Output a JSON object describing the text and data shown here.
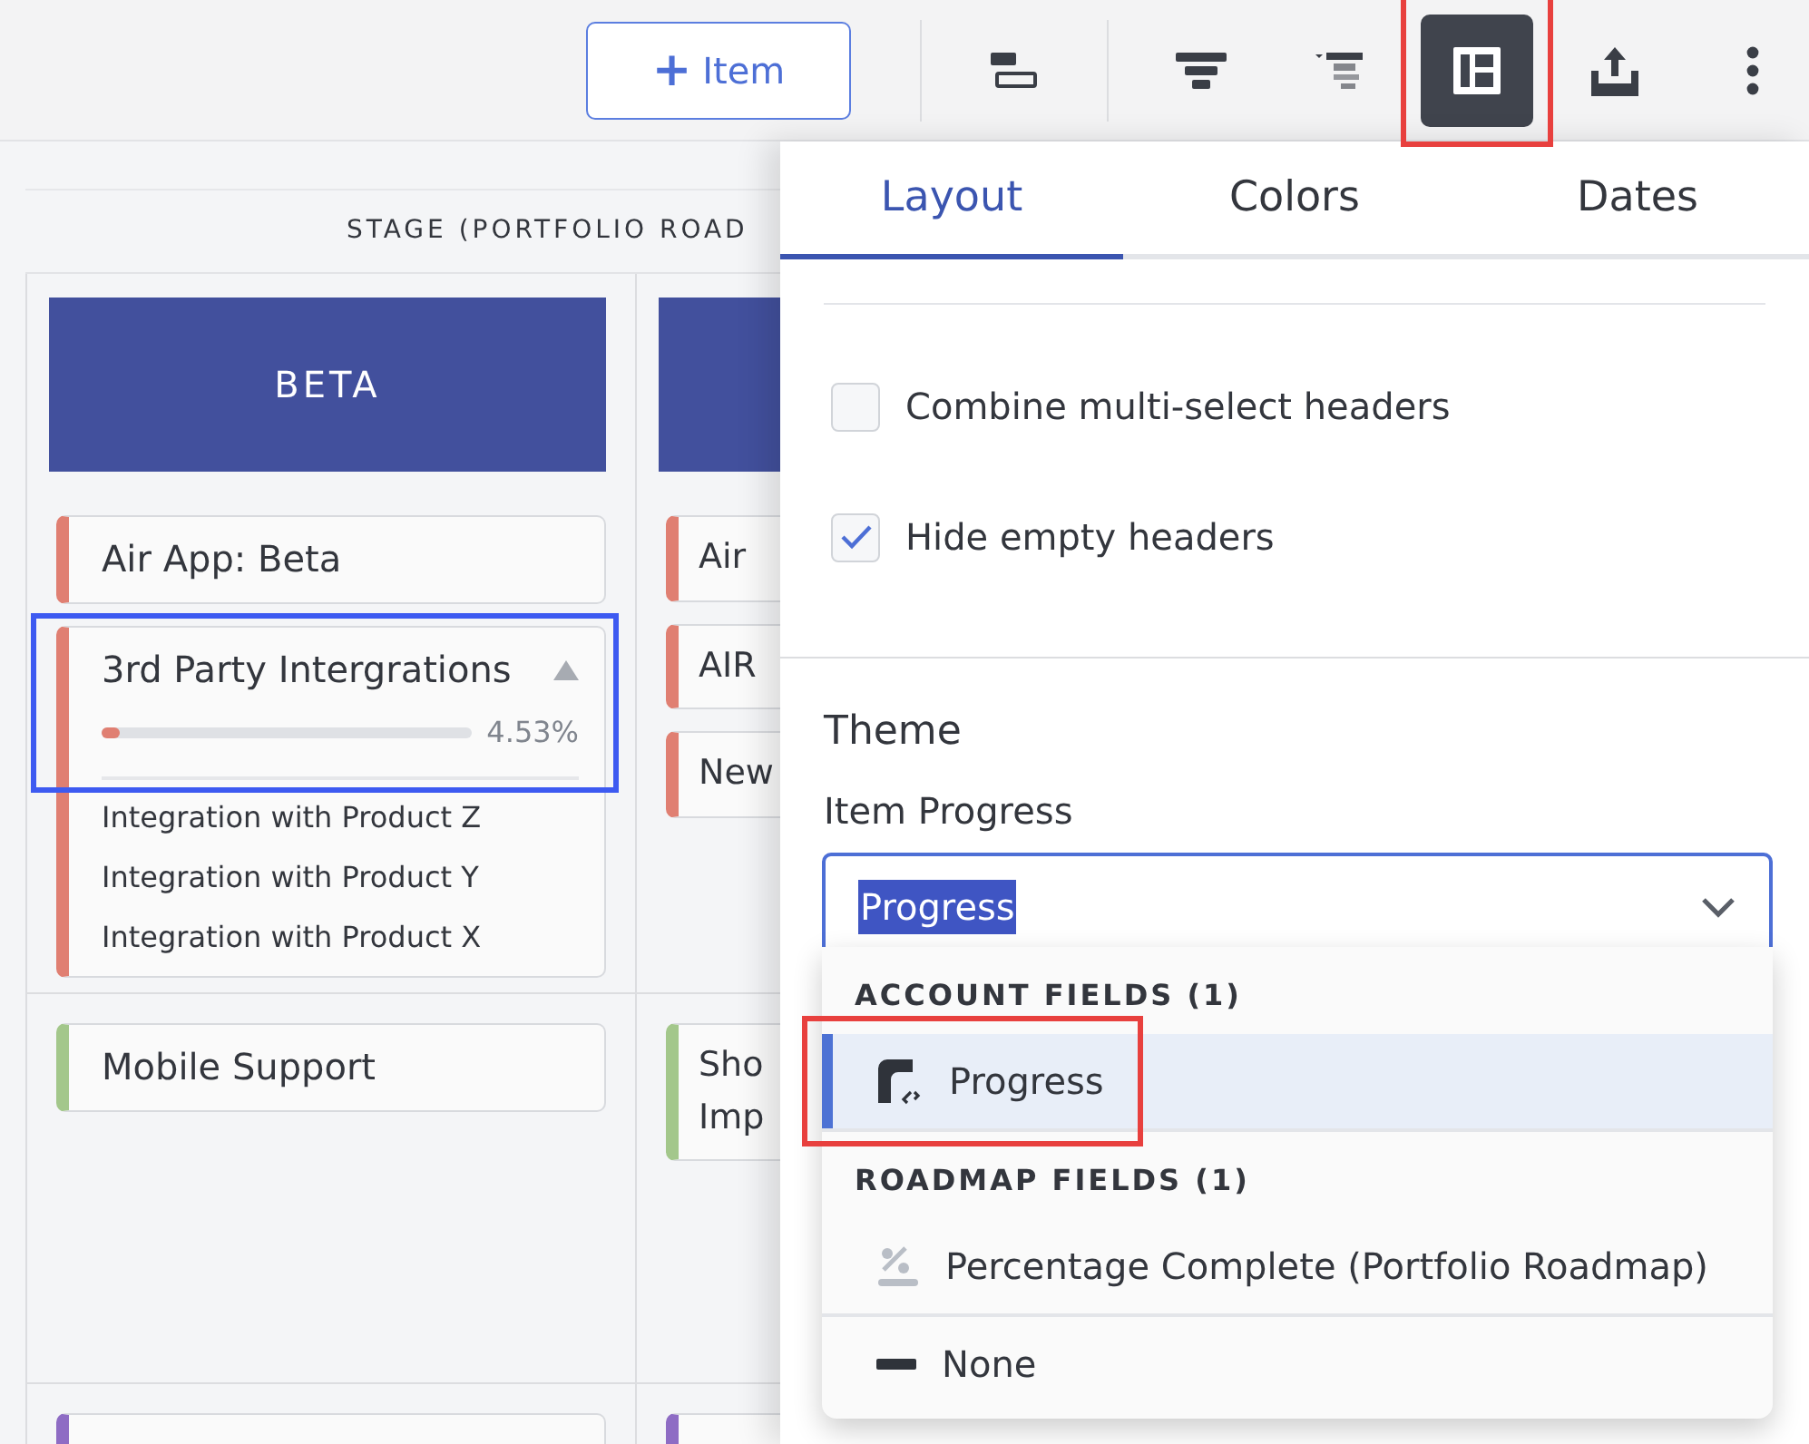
{
  "toolbar": {
    "add_button": {
      "icon": "+",
      "label": "Item"
    },
    "tools": [
      {
        "kind": "bars",
        "selected": false
      },
      {
        "kind": "funnel",
        "selected": false
      },
      {
        "kind": "outline",
        "selected": false
      },
      {
        "kind": "layout",
        "selected": true
      },
      {
        "kind": "export",
        "selected": false
      },
      {
        "kind": "more",
        "selected": false
      }
    ]
  },
  "board": {
    "group_header": "STAGE (PORTFOLIO ROAD",
    "columns": [
      {
        "header": "BETA",
        "lanes": [
          {
            "cards": [
              {
                "title": "Air App: Beta",
                "color": "#e07f72"
              },
              {
                "title": "3rd Party Intergrations",
                "color": "#e07f72",
                "expanded": true,
                "progress": {
                  "level": 0.0453,
                  "reading": "4.53%"
                },
                "children": [
                  "Integration with Product Z",
                  "Integration with Product Y",
                  "Integration with Product X"
                ]
              }
            ]
          },
          {
            "cards": [
              {
                "title": "Mobile Support",
                "color": "#a3c78b"
              }
            ]
          },
          {
            "cards": [
              {
                "color": "#8e6cc4"
              }
            ]
          }
        ]
      },
      {
        "lanes": [
          {
            "cards": [
              {
                "title": "Air",
                "color": "#e07f72"
              },
              {
                "title": "AIR",
                "color": "#e07f72"
              },
              {
                "title": "New",
                "color": "#e07f72"
              }
            ]
          },
          {
            "cards": [
              {
                "title": "Sho Imp",
                "color": "#a3c78b"
              }
            ]
          },
          {
            "cards": [
              {
                "color": "#8e6cc4"
              }
            ]
          }
        ]
      }
    ]
  },
  "panel": {
    "tabs": [
      {
        "label": "Layout",
        "selected": true
      },
      {
        "label": "Colors",
        "selected": false
      },
      {
        "label": "Dates",
        "selected": false
      }
    ],
    "options": [
      {
        "label": "Combine multi-select headers",
        "checked": false
      },
      {
        "label": "Hide empty headers",
        "checked": true
      }
    ],
    "section_title": "Theme",
    "field_label": "Item Progress",
    "select": {
      "value": "Progress",
      "highlighted": true
    },
    "menu": {
      "groups": [
        {
          "heading": "ACCOUNT FIELDS (1)",
          "items": [
            {
              "kind": "account",
              "label": "Progress",
              "selected": true
            }
          ]
        },
        {
          "heading": "ROADMAP FIELDS (1)",
          "items": [
            {
              "kind": "roadmap",
              "label": "Percentage Complete (Portfolio Roadmap)",
              "selected": false
            }
          ]
        },
        {
          "items": [
            {
              "kind": "none",
              "label": "None",
              "selected": false
            }
          ]
        }
      ]
    }
  },
  "annotations": [
    {
      "kind": "tool",
      "color": "#e8403e"
    },
    {
      "kind": "card",
      "color": "#3d5af1"
    },
    {
      "kind": "option",
      "color": "#e8403e"
    }
  ]
}
